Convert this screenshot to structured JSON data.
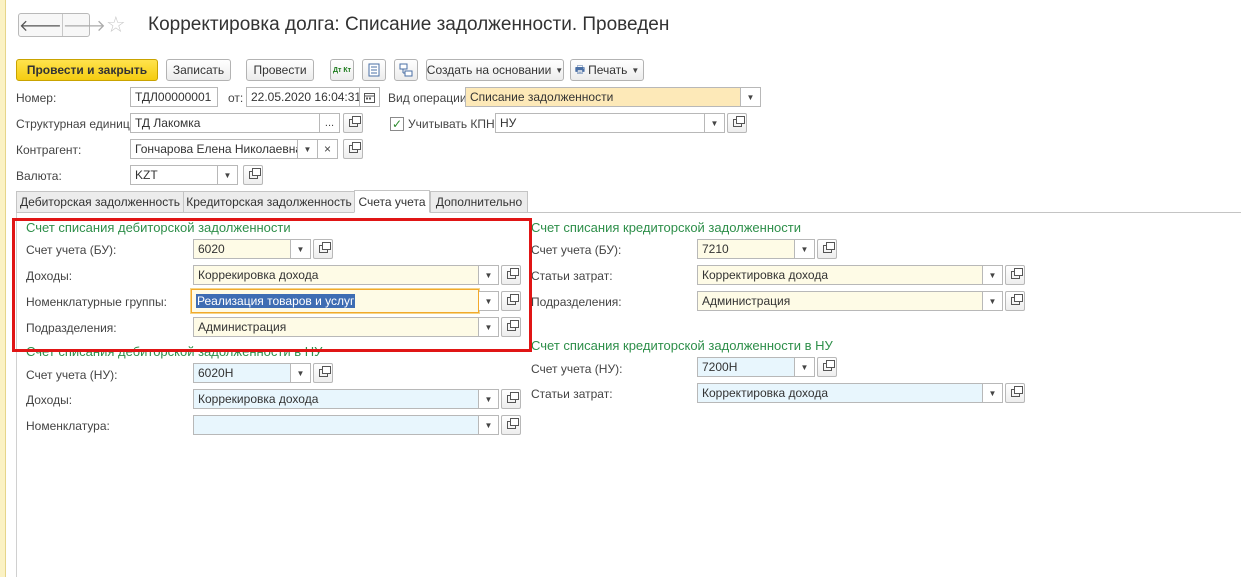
{
  "window": {
    "title": "Корректировка долга: Списание задолженности. Проведен",
    "nav_back": "🡐",
    "nav_forward": "🡒",
    "favorite": "☆"
  },
  "toolbar": {
    "post_close": "Провести и закрыть",
    "save": "Записать",
    "post": "Провести",
    "dtkt_icon": "Дт Кт",
    "create_based": "Создать на основании",
    "print": "Печать"
  },
  "header": {
    "number_label": "Номер:",
    "number_value": "ТДЛ00000001",
    "date_label": "от:",
    "date_value": "22.05.2020 16:04:31",
    "operation_label": "Вид операции:",
    "operation_value": "Списание задолженности",
    "unit_label": "Структурная единица:",
    "unit_value": "ТД Лакомка",
    "unit_ellipsis": "...",
    "kpn_label": "Учитывать КПН",
    "kpn_checked": true,
    "kpn_value": "НУ",
    "counterparty_label": "Контрагент:",
    "counterparty_value": "Гончарова Елена Николаевна",
    "clear_glyph": "×",
    "currency_label": "Валюта:",
    "currency_value": "KZT"
  },
  "tabs": [
    {
      "label": "Дебиторская задолженность",
      "active": false
    },
    {
      "label": "Кредиторская задолженность",
      "active": false
    },
    {
      "label": "Счета учета",
      "active": true
    },
    {
      "label": "Дополнительно",
      "active": false
    }
  ],
  "debit_bu": {
    "title": "Счет списания дебиторской задолженности",
    "account_label": "Счет учета (БУ):",
    "account_value": "6020",
    "income_label": "Доходы:",
    "income_value": "Коррекировка дохода",
    "nomgroup_label": "Номенклатурные группы:",
    "nomgroup_value": "Реализация товаров и услуг",
    "dept_label": "Подразделения:",
    "dept_value": "Администрация"
  },
  "debit_nu": {
    "title": "Счет списания дебиторской задолженности в НУ",
    "account_label": "Счет учета (НУ):",
    "account_value": "6020Н",
    "income_label": "Доходы:",
    "income_value": "Коррекировка дохода",
    "nom_label": "Номенклатура:",
    "nom_value": ""
  },
  "credit_bu": {
    "title": "Счет списания кредиторской задолженности",
    "account_label": "Счет учета (БУ):",
    "account_value": "7210",
    "expense_label": "Статьи затрат:",
    "expense_value": "Корректировка дохода",
    "dept_label": "Подразделения:",
    "dept_value": "Администрация"
  },
  "credit_nu": {
    "title": "Счет списания кредиторской задолженности в НУ",
    "account_label": "Счет учета (НУ):",
    "account_value": "7200Н",
    "expense_label": "Статьи затрат:",
    "expense_value": "Корректировка дохода"
  },
  "colors": {
    "highlight_frame": "#e01515",
    "section_title": "#2e8f4a",
    "primary_button": "#f5cc10"
  }
}
